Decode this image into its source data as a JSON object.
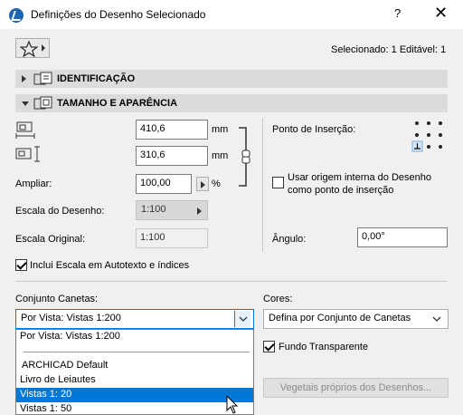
{
  "window": {
    "title": "Definições do Desenho Selecionado",
    "help": "?",
    "close": "✕"
  },
  "header": {
    "selected_text": "Selecionado: 1 Editável: 1"
  },
  "sections": [
    {
      "title": "IDENTIFICAÇÃO",
      "expanded": false
    },
    {
      "title": "TAMANHO E APARÊNCIA",
      "expanded": true
    }
  ],
  "size": {
    "width_value": "410,6",
    "width_unit": "mm",
    "height_value": "310,6",
    "height_unit": "mm",
    "scale_label": "Ampliar:",
    "scale_value": "100,00",
    "scale_unit": "%",
    "drawing_scale_label": "Escala do Desenho:",
    "drawing_scale_value": "1:100",
    "original_scale_label": "Escala Original:",
    "original_scale_value": "1:100"
  },
  "insertion": {
    "label": "Ponto de Inserção:",
    "use_origin_label_1": "Usar origem interna do Desenho",
    "use_origin_label_2": "como ponto de inserção",
    "use_origin_checked": false,
    "angle_label": "Ângulo:",
    "angle_value": "0,00°"
  },
  "include_scale": {
    "label": "Inclui Escala em Autotexto e índices",
    "checked": true
  },
  "pen_set": {
    "label": "Conjunto Canetas:",
    "value": "Por Vista: Vistas 1:200",
    "options": [
      "Por Vista: Vistas 1:200",
      "ARCHICAD Default",
      "Livro de Leiautes",
      "Vistas 1: 20",
      "Vistas 1: 50"
    ],
    "highlighted": "Vistas 1: 20"
  },
  "colors": {
    "label": "Cores:",
    "value": "Defina por Conjunto de Canetas",
    "transparent_label": "Fundo Transparente",
    "transparent_checked": true,
    "vectorial_button": "Vegetais próprios dos Desenhos..."
  },
  "accent_color": "#0078d7"
}
